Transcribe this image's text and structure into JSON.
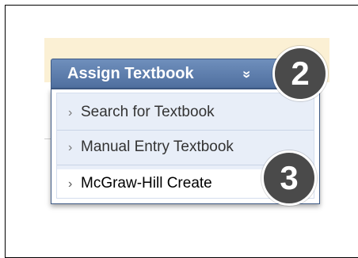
{
  "menu": {
    "button_label": "Assign Textbook",
    "chevron": "»",
    "items": [
      {
        "label": "Search for Textbook",
        "arrow": "›"
      },
      {
        "label": "Manual Entry Textbook",
        "arrow": "›"
      },
      {
        "label": "McGraw-Hill Create",
        "arrow": "›"
      }
    ]
  },
  "callouts": {
    "step2": "2",
    "step3": "3"
  },
  "colors": {
    "button_bg": "#5a7aaa",
    "dropdown_bg": "#e8eef8",
    "badge_bg": "#4a4a4a",
    "yellow_band": "#fbf0d4"
  }
}
